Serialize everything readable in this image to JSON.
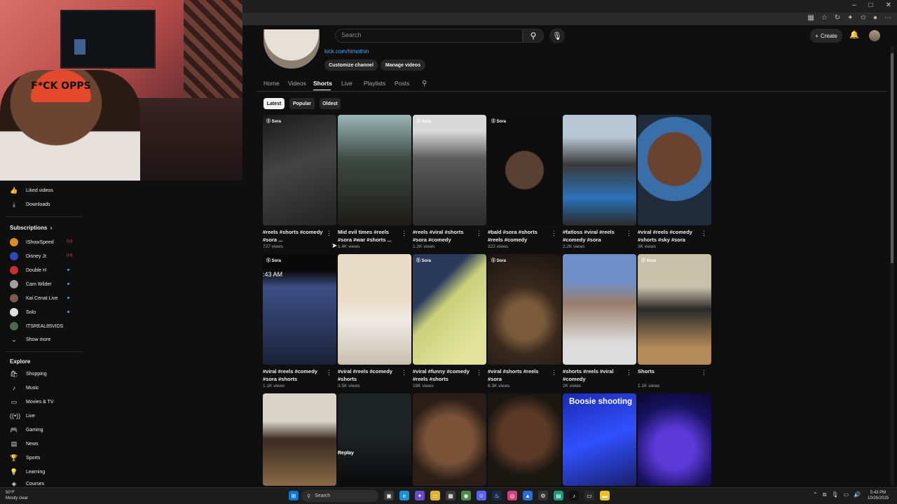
{
  "browser": {
    "window_controls": [
      "–",
      "□",
      "✕"
    ]
  },
  "youtube": {
    "search_placeholder": "Search",
    "create_label": "Create",
    "channel_link": "kick.com/himothin",
    "customize_label": "Customize channel",
    "manage_label": "Manage videos",
    "tabs": [
      "Home",
      "Videos",
      "Shorts",
      "Live",
      "Playlists",
      "Posts"
    ],
    "active_tab": "Shorts",
    "chips": [
      "Latest",
      "Popular",
      "Oldest"
    ],
    "active_chip": "Latest"
  },
  "shorts": [
    {
      "title": "#reels #shorts #comedy #sora ...",
      "views": "727 views",
      "badge": "Sora",
      "overlay": ""
    },
    {
      "title": "Mid evil times #reels #sora #war #shorts ...",
      "views": "1.4K views",
      "badge": "",
      "overlay": ""
    },
    {
      "title": "#reels #viral #shorts #sora #comedy",
      "views": "1.2K views",
      "badge": "Sora",
      "overlay": ""
    },
    {
      "title": "#bald #sora #shorts #reels #comedy",
      "views": "322 views",
      "badge": "Sora",
      "overlay": ""
    },
    {
      "title": "#fatloss #viral #reels #comedy #sora",
      "views": "2.2K views",
      "badge": "",
      "overlay": ""
    },
    {
      "title": "#viral #reels #comedy #shorts #sky #sora",
      "views": "3K views",
      "badge": "",
      "overlay": ""
    },
    {
      "title": "#viral #reels #comedy #sora #shorts",
      "views": "1.1K views",
      "badge": "Sora",
      "overlay": ":43 AM"
    },
    {
      "title": "#viral #reels #comedy #shorts",
      "views": "3.5K views",
      "badge": "",
      "overlay": ""
    },
    {
      "title": "#viral #funny #comedy #reels #shorts",
      "views": "19K views",
      "badge": "Sora",
      "overlay": ""
    },
    {
      "title": "#viral #shorts #reels #sora",
      "views": "6.3K views",
      "badge": "Sora",
      "overlay": ""
    },
    {
      "title": "#shorts #reels #viral #comedy",
      "views": "2K views",
      "badge": "",
      "overlay": ""
    },
    {
      "title": "Shorts",
      "views": "1.1K views",
      "badge": "Sora",
      "overlay": ""
    },
    {
      "title": "",
      "views": "",
      "badge": "",
      "overlay": ""
    },
    {
      "title": "",
      "views": "",
      "badge": "",
      "overlay": "Replay"
    },
    {
      "title": "",
      "views": "",
      "badge": "",
      "overlay": ""
    },
    {
      "title": "",
      "views": "",
      "badge": "",
      "overlay": ""
    },
    {
      "title": "",
      "views": "",
      "badge": "",
      "overlay": "Boosie shooting"
    },
    {
      "title": "",
      "views": "",
      "badge": "",
      "overlay": ""
    }
  ],
  "sidebar": {
    "items_top": [
      {
        "label": "Liked videos",
        "icon": "thumbs-up-icon"
      },
      {
        "label": "Downloads",
        "icon": "download-icon"
      }
    ],
    "subscriptions_heading": "Subscriptions",
    "subscriptions": [
      {
        "label": "IShowSpeed",
        "status": "live"
      },
      {
        "label": "Disney Jr.",
        "status": "live"
      },
      {
        "label": "Double H",
        "status": "new"
      },
      {
        "label": "Cam Wilder",
        "status": "new"
      },
      {
        "label": "Kai Cenat Live",
        "status": "new"
      },
      {
        "label": "Solo",
        "status": "new"
      },
      {
        "label": "ITSREAL85VIDS",
        "status": "new"
      }
    ],
    "show_more": "Show more",
    "explore_heading": "Explore",
    "explore": [
      {
        "label": "Shopping",
        "icon": "shopping-bag-icon"
      },
      {
        "label": "Music",
        "icon": "music-note-icon"
      },
      {
        "label": "Movies & TV",
        "icon": "film-icon"
      },
      {
        "label": "Live",
        "icon": "live-icon"
      },
      {
        "label": "Gaming",
        "icon": "gamepad-icon"
      },
      {
        "label": "News",
        "icon": "news-icon"
      },
      {
        "label": "Sports",
        "icon": "trophy-icon"
      },
      {
        "label": "Learning",
        "icon": "lightbulb-icon"
      },
      {
        "label": "Courses",
        "icon": "course-icon"
      }
    ]
  },
  "webcam": {
    "cap_text": "F*CK OPPS"
  },
  "taskbar": {
    "weather_temp": "50°F",
    "weather_desc": "Mostly clear",
    "search_label": "Search",
    "time": "5:43 PM",
    "date": "10/26/2025"
  },
  "colors": {
    "accent_link": "#3ea6ff",
    "live_red": "#ff4e45",
    "background": "#0f0f0f"
  }
}
